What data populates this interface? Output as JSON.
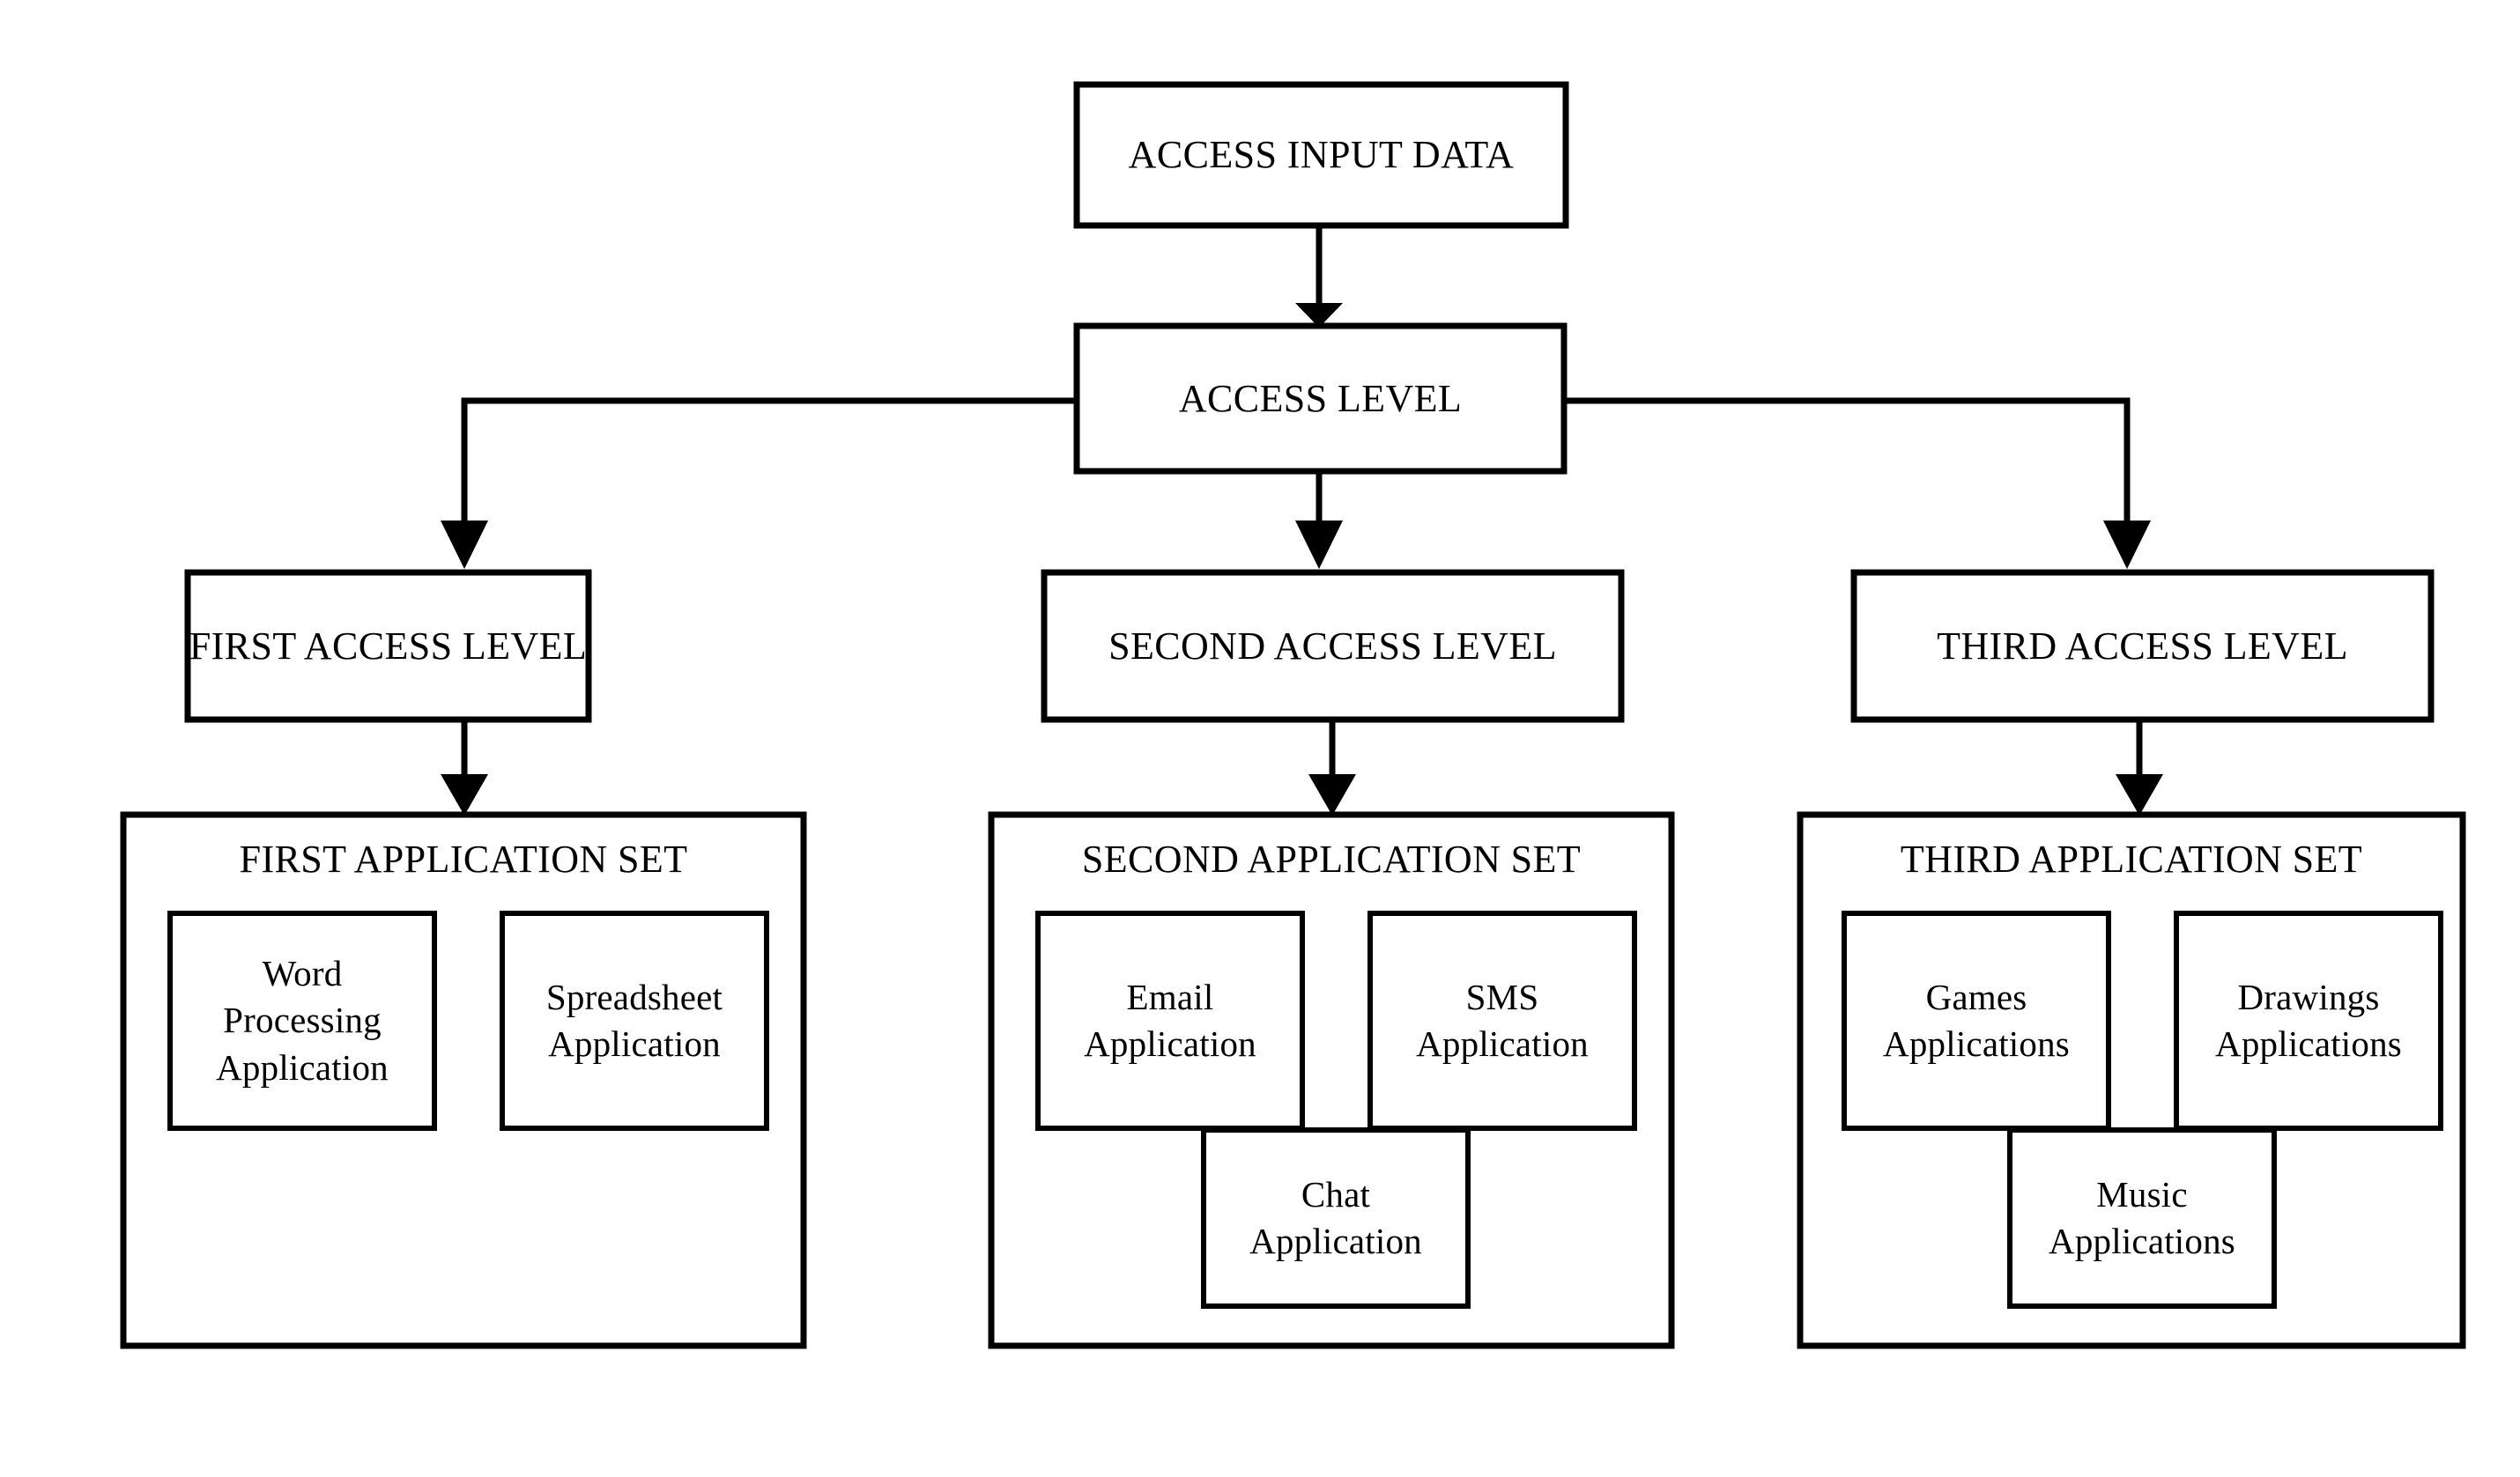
{
  "diagram": {
    "type": "flowchart",
    "title": "Access Level Application Sets",
    "background_color": "#ffffff",
    "line_color": "#000000",
    "nodes": {
      "input": {
        "label": "ACCESS INPUT DATA"
      },
      "access_level": {
        "label": "ACCESS LEVEL"
      },
      "level_1": {
        "label": "FIRST ACCESS LEVEL"
      },
      "level_2": {
        "label": "SECOND ACCESS LEVEL"
      },
      "level_3": {
        "label": "THIRD ACCESS LEVEL"
      },
      "set_1": {
        "label": "FIRST APPLICATION SET",
        "apps": [
          {
            "label": "Word\nProcessing\nApplication"
          },
          {
            "label": "Spreadsheet\nApplication"
          }
        ]
      },
      "set_2": {
        "label": "SECOND APPLICATION SET",
        "apps": [
          {
            "label": "Email\nApplication"
          },
          {
            "label": "SMS\nApplication"
          },
          {
            "label": "Chat\nApplication"
          }
        ]
      },
      "set_3": {
        "label": "THIRD APPLICATION SET",
        "apps": [
          {
            "label": "Games\nApplications"
          },
          {
            "label": "Drawings\nApplications"
          },
          {
            "label": "Music\nApplications"
          }
        ]
      }
    },
    "edges": [
      {
        "from": "input",
        "to": "access_level",
        "style": "straight-down-arrow"
      },
      {
        "from": "access_level",
        "to": "level_1",
        "style": "elbow-left-down-arrow"
      },
      {
        "from": "access_level",
        "to": "level_2",
        "style": "straight-down-arrow"
      },
      {
        "from": "access_level",
        "to": "level_3",
        "style": "elbow-right-down-arrow"
      },
      {
        "from": "level_1",
        "to": "set_1",
        "style": "straight-down-arrow"
      },
      {
        "from": "level_2",
        "to": "set_2",
        "style": "straight-down-arrow"
      },
      {
        "from": "level_3",
        "to": "set_3",
        "style": "straight-down-arrow"
      }
    ]
  }
}
